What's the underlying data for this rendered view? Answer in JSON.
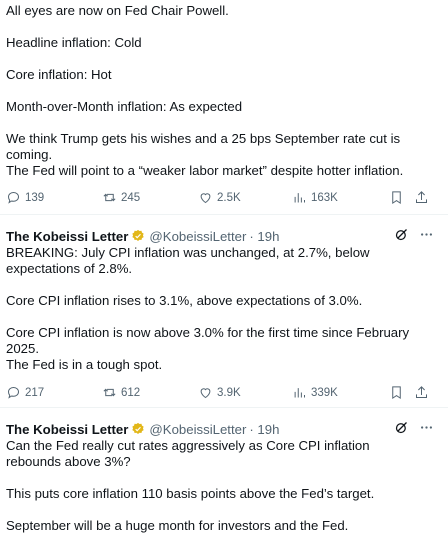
{
  "tweet1": {
    "paras": [
      "All eyes are now on Fed Chair Powell.",
      "Headline inflation: Cold",
      "Core inflation: Hot",
      "Month-over-Month inflation: As expected",
      "We think Trump gets his wishes and a 25 bps September rate cut is coming.",
      "The Fed will point to a “weaker labor market” despite hotter inflation."
    ],
    "replies": "139",
    "retweets": "245",
    "likes": "2.5K",
    "views": "163K"
  },
  "tweet2": {
    "name": "The Kobeissi Letter",
    "handle": "@KobeissiLetter",
    "time": "· 19h",
    "paras": [
      "BREAKING: July CPI inflation was unchanged, at 2.7%, below expectations of 2.8%.",
      "Core CPI inflation rises to 3.1%, above expectations of 3.0%.",
      "Core CPI inflation is now above 3.0% for the first time since February 2025.",
      "The Fed is in a tough spot."
    ],
    "replies": "217",
    "retweets": "612",
    "likes": "3.9K",
    "views": "339K"
  },
  "tweet3": {
    "name": "The Kobeissi Letter",
    "handle": "@KobeissiLetter",
    "time": "· 19h",
    "paras": [
      "Can the Fed really cut rates aggressively as Core CPI inflation rebounds above 3%?",
      "This puts core inflation 110 basis points above the Fed’s target.",
      "September will be a huge month for investors and the Fed."
    ]
  },
  "icons": {
    "verified_color": "#e2b719",
    "action_color": "#536471"
  }
}
